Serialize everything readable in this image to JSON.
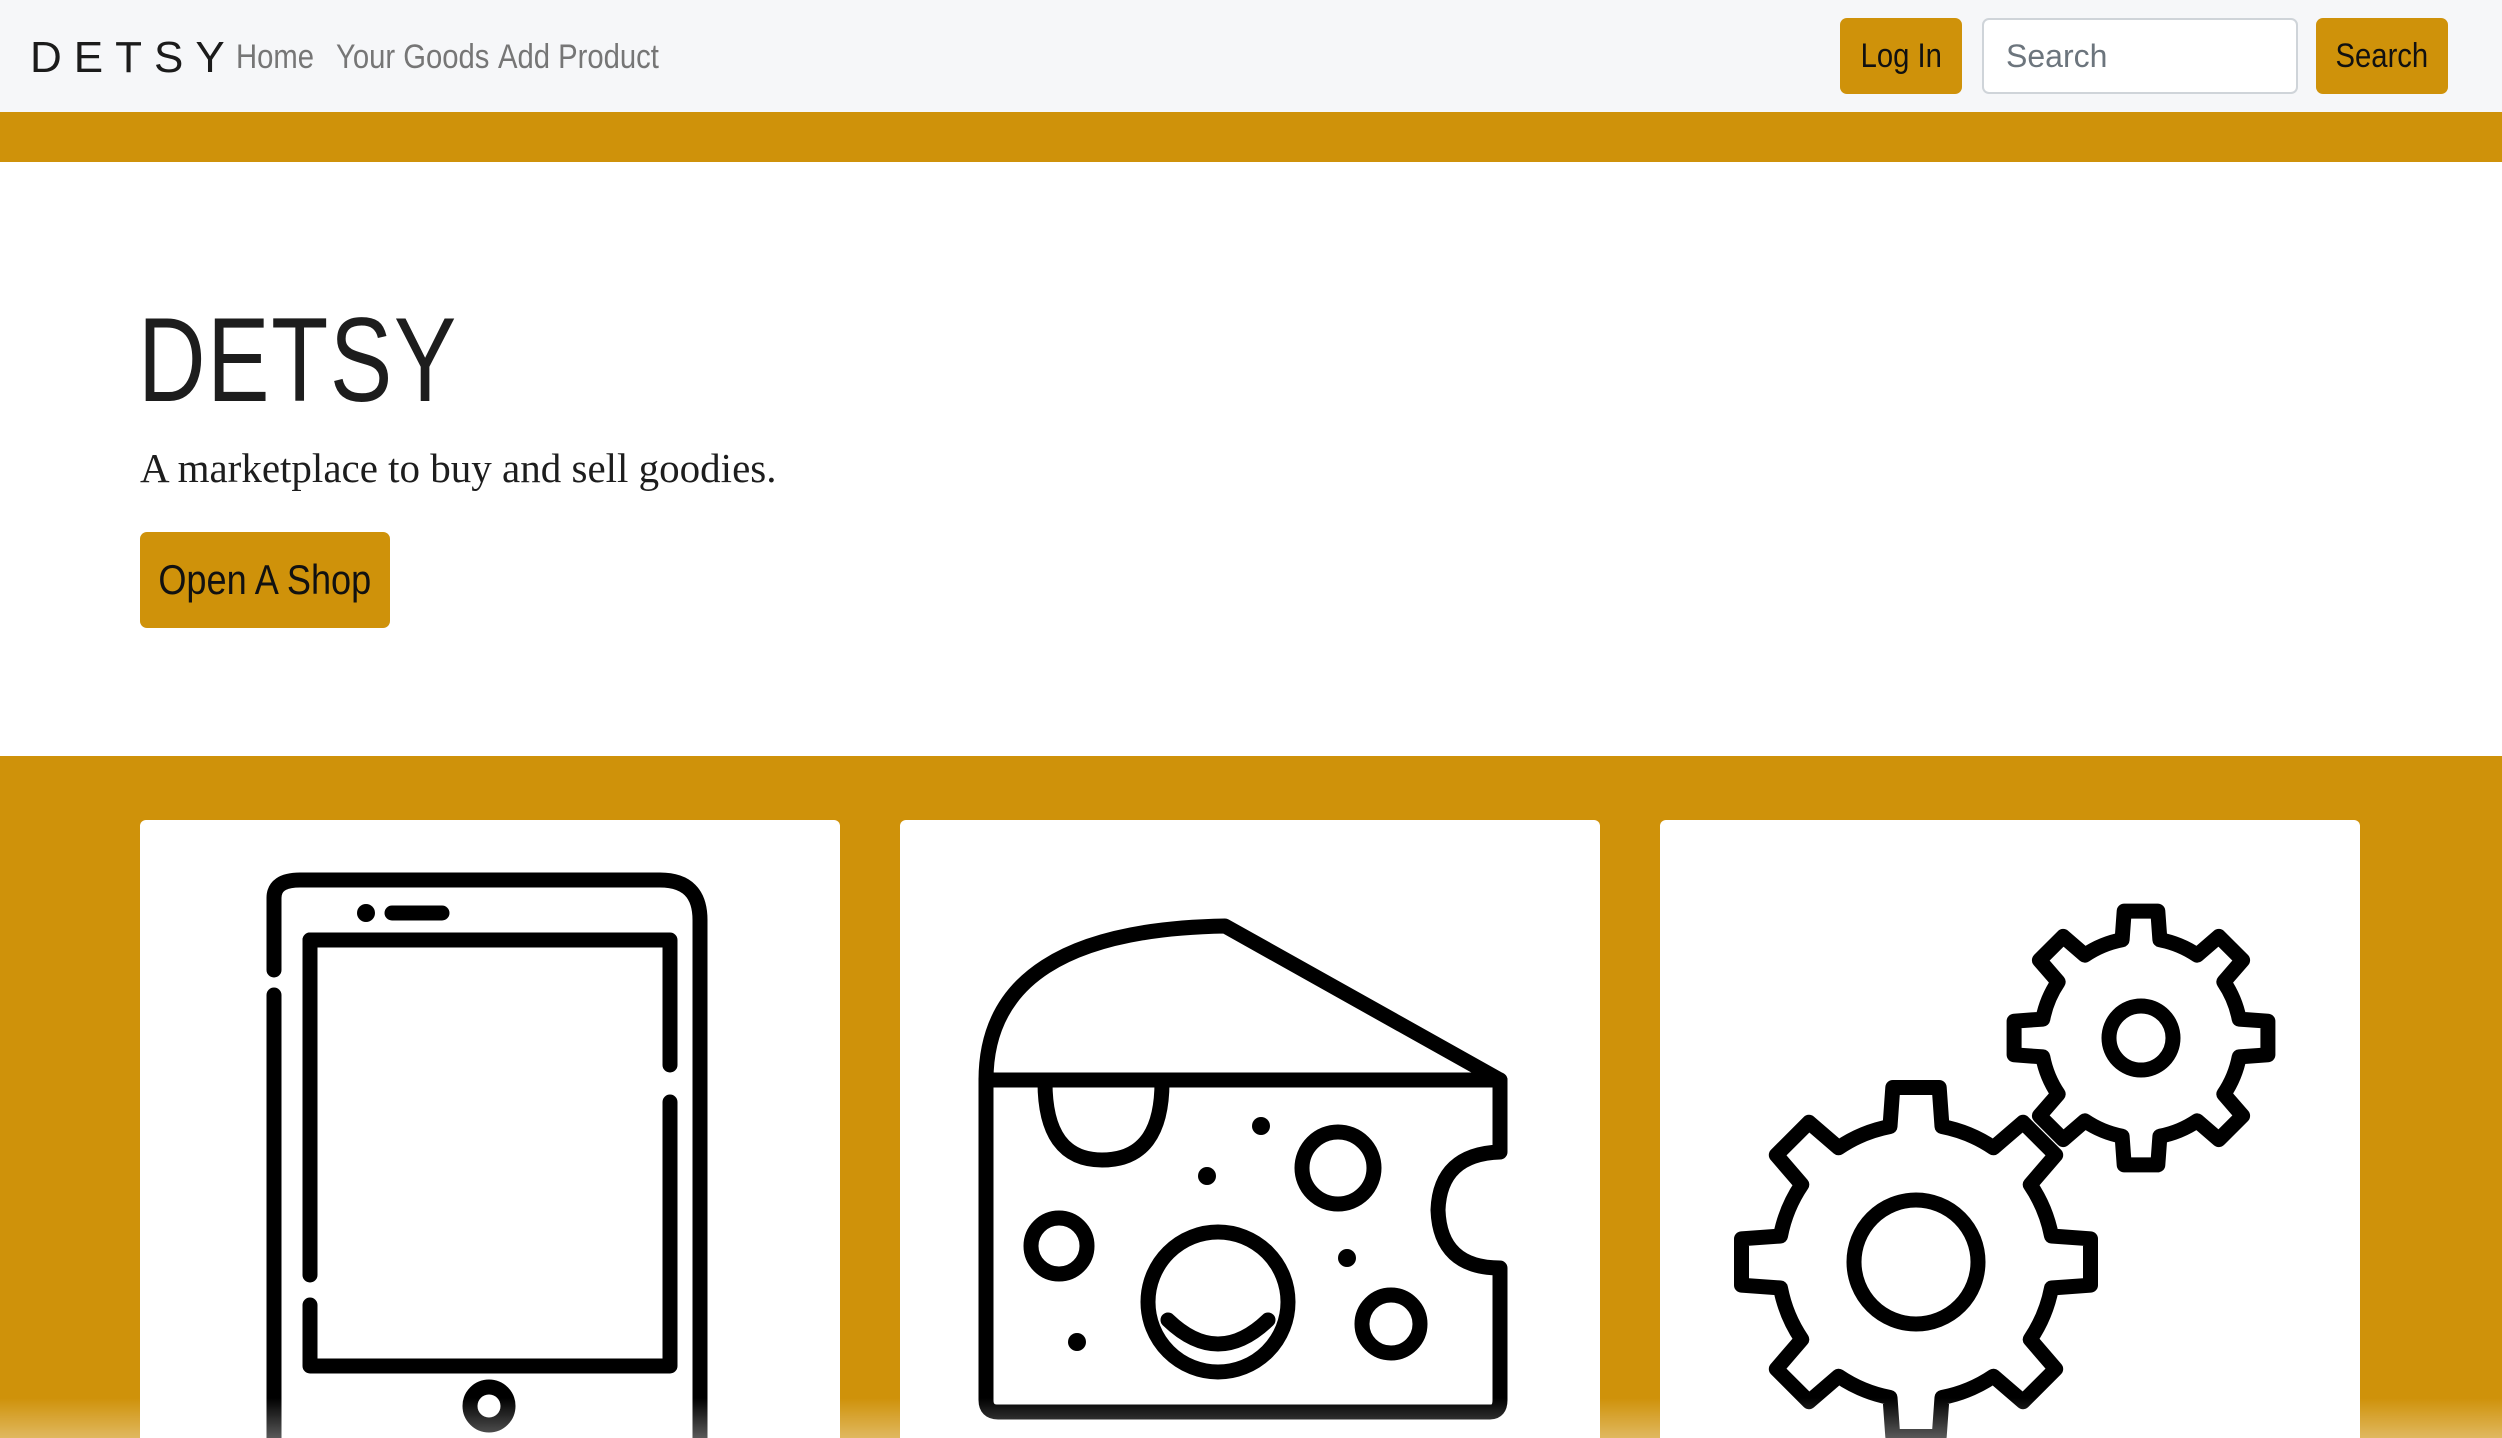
{
  "navbar": {
    "brand": "DETSY",
    "links": [
      "Home",
      "Your Goods",
      "Add Product"
    ],
    "login_label": "Log In",
    "search_placeholder": "Search",
    "search_button_label": "Search"
  },
  "hero": {
    "title": "DETSY",
    "subtitle": "A marketplace to buy and sell goodies.",
    "cta_label": "Open A Shop"
  },
  "categories": [
    {
      "icon": "tablet-icon"
    },
    {
      "icon": "cheese-icon"
    },
    {
      "icon": "gears-icon"
    }
  ],
  "colors": {
    "accent": "#cf920a",
    "navbar_bg": "#f6f7f9",
    "text_dark": "#1d1d1d",
    "nav_link": "#767676"
  }
}
